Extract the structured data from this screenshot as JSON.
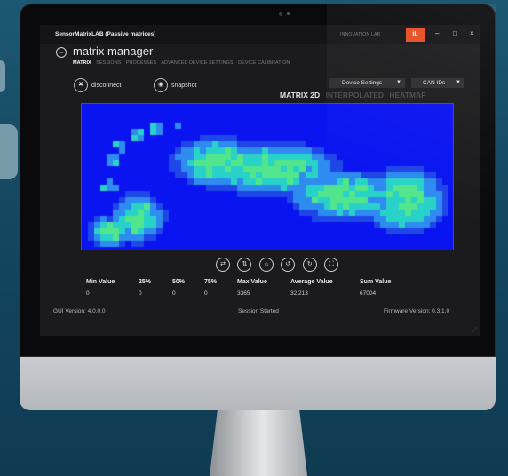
{
  "app": {
    "title": "SensorMatrixLAB (Passive matrices)",
    "brand_text": "INNOVATION LAB",
    "brand_logo": "iL",
    "minimize": "–",
    "maximize": "□",
    "close": "×"
  },
  "page": {
    "title": "matrix manager",
    "tabs": [
      "MATRIX",
      "SESSIONS",
      "PROCESSES",
      "ADVANCED DEVICE SETTINGS",
      "DEVICE CALIBRATION"
    ],
    "active_tab": "MATRIX"
  },
  "actions": {
    "disconnect": "disconnect",
    "snapshot": "snapshot"
  },
  "dropdowns": {
    "device_settings": "Device Settings",
    "can_ids": "CAN IDs"
  },
  "view_modes": [
    "MATRIX 2D",
    "INTERPOLATED",
    "HEATMAP"
  ],
  "active_view": "MATRIX 2D",
  "heatmap": {
    "colors": {
      "background": "#0a14f0",
      "frame": "#c81f1f",
      "low": "#1f46e6",
      "mid": "#2e8cf0",
      "high": "#29d2c8",
      "peak": "#52e68c"
    }
  },
  "controls": [
    "swap-icon",
    "flip-icon",
    "home-icon",
    "rotate-ccw-icon",
    "rotate-cw-icon",
    "fullscreen-icon"
  ],
  "stats": {
    "labels": [
      "Min Value",
      "25%",
      "50%",
      "75%",
      "Max Value",
      "Average Value",
      "Sum Value"
    ],
    "values": [
      "0",
      "0",
      "0",
      "0",
      "3365",
      "32.213",
      "67004"
    ]
  },
  "footer": {
    "gui_version": "GUI Version: 4.0.0.0",
    "session_status": "Session Started",
    "firmware_version": "Firmware Version: 0.3.1.0"
  }
}
